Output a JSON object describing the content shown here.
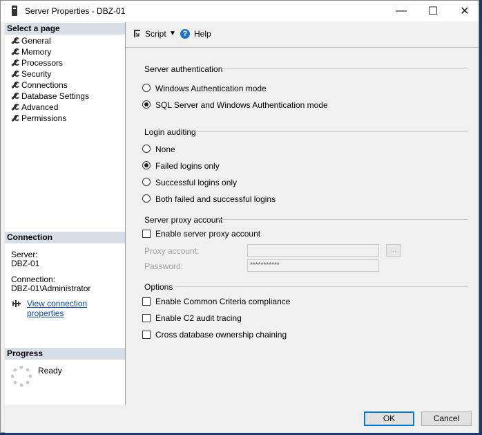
{
  "window": {
    "title": "Server Properties - DBZ-01",
    "minimize": "—",
    "maximize": "☐",
    "close": "✕"
  },
  "left": {
    "select_page_header": "Select a page",
    "pages": [
      "General",
      "Memory",
      "Processors",
      "Security",
      "Connections",
      "Database Settings",
      "Advanced",
      "Permissions"
    ],
    "connection_header": "Connection",
    "server_label": "Server:",
    "server_value": "DBZ-01",
    "connection_label": "Connection:",
    "connection_value": "DBZ-01\\Administrator",
    "view_connection_link": "View connection properties",
    "progress_header": "Progress",
    "progress_status": "Ready"
  },
  "toolbar": {
    "script_label": "Script",
    "help_label": "Help"
  },
  "server_auth": {
    "title": "Server authentication",
    "options": [
      "Windows Authentication mode",
      "SQL Server and Windows Authentication mode"
    ],
    "selected_index": 1
  },
  "login_auditing": {
    "title": "Login auditing",
    "options": [
      "None",
      "Failed logins only",
      "Successful logins only",
      "Both failed and successful logins"
    ],
    "selected_index": 1
  },
  "proxy": {
    "title": "Server proxy account",
    "enable_label": "Enable server proxy account",
    "enable_checked": false,
    "account_label": "Proxy account:",
    "account_value": "",
    "password_label": "Password:",
    "password_value": "***********",
    "browse_label": "..."
  },
  "options": {
    "title": "Options",
    "items": [
      {
        "label": "Enable Common Criteria compliance",
        "checked": false
      },
      {
        "label": "Enable C2 audit tracing",
        "checked": false
      },
      {
        "label": "Cross database ownership chaining",
        "checked": false
      }
    ]
  },
  "footer": {
    "ok_label": "OK",
    "cancel_label": "Cancel"
  }
}
